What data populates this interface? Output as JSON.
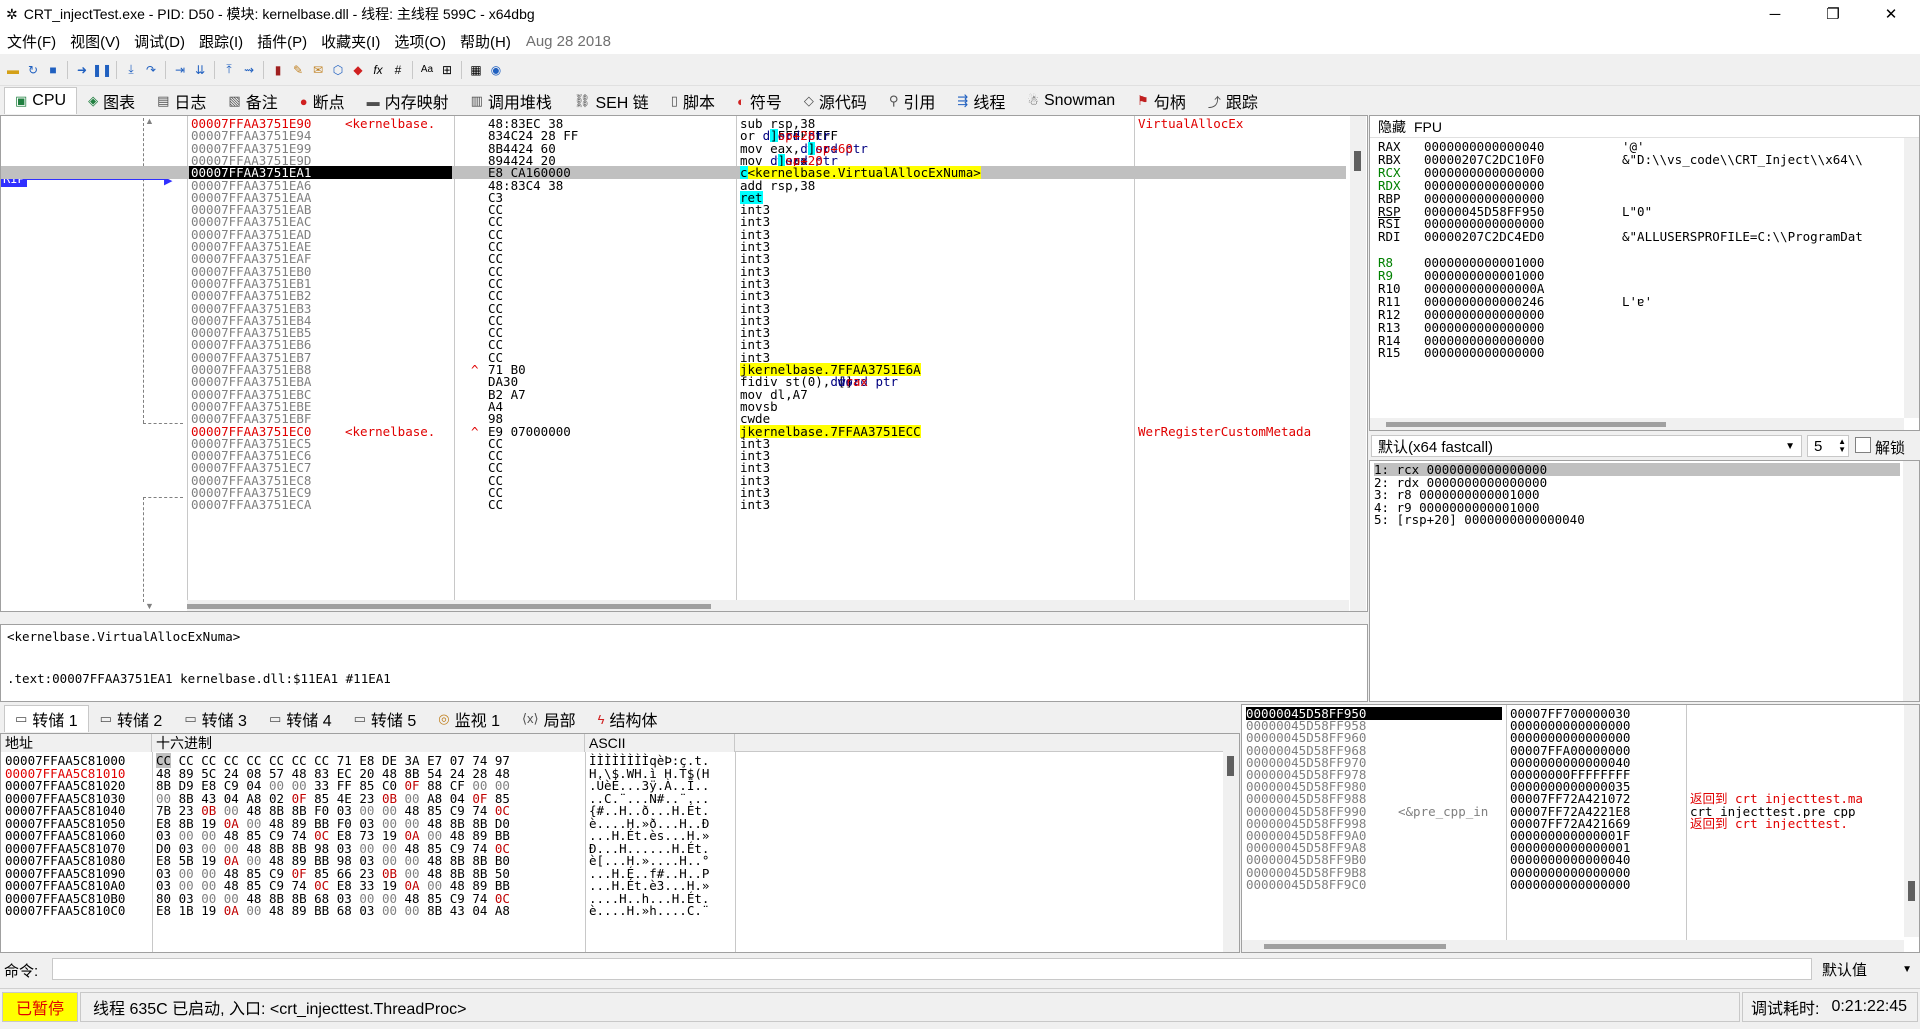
{
  "titlebar": {
    "title": "CRT_injectTest.exe - PID: D50 - 模块: kernelbase.dll - 线程: 主线程 599C - x64dbg"
  },
  "menu": {
    "items": [
      "文件(F)",
      "视图(V)",
      "调试(D)",
      "跟踪(I)",
      "插件(P)",
      "收藏夹(I)",
      "选项(O)",
      "帮助(H)"
    ],
    "date": "Aug 28 2018"
  },
  "tabs": [
    {
      "label": "CPU",
      "icon": "cpu-icon"
    },
    {
      "label": "图表",
      "icon": "graph-icon"
    },
    {
      "label": "日志",
      "icon": "log-icon"
    },
    {
      "label": "备注",
      "icon": "notes-icon"
    },
    {
      "label": "断点",
      "icon": "breakpoint-icon"
    },
    {
      "label": "内存映射",
      "icon": "memory-map-icon"
    },
    {
      "label": "调用堆栈",
      "icon": "call-stack-icon"
    },
    {
      "label": "SEH 链",
      "icon": "seh-icon"
    },
    {
      "label": "脚本",
      "icon": "script-icon"
    },
    {
      "label": "符号",
      "icon": "symbol-icon"
    },
    {
      "label": "源代码",
      "icon": "source-icon"
    },
    {
      "label": "引用",
      "icon": "references-icon"
    },
    {
      "label": "线程",
      "icon": "threads-icon"
    },
    {
      "label": "Snowman",
      "icon": "snowman-icon"
    },
    {
      "label": "句柄",
      "icon": "handles-icon"
    },
    {
      "label": "跟踪",
      "icon": "trace-icon"
    }
  ],
  "disasm": {
    "rip_label": "RIP",
    "rows": [
      {
        "addr": "00007FFAA3751E90",
        "label": "<kernelbase.",
        "bytes": "48:83EC 38",
        "instr": "sub rsp,38",
        "cmt": "VirtualAllocEx",
        "red": true
      },
      {
        "addr": "00007FFAA3751E94",
        "bytes": "834C24 28 FF",
        "instr": "or dword ptr ss:[rsp+28],FFFFFFFF"
      },
      {
        "addr": "00007FFAA3751E99",
        "bytes": "8B4424 60",
        "instr": "mov eax,dword ptr ss:[rsp+60]"
      },
      {
        "addr": "00007FFAA3751E9D",
        "bytes": "894424 20",
        "instr": "mov dword ptr ss:[rsp+20],eax"
      },
      {
        "addr": "00007FFAA3751EA1",
        "bytes": "E8 CA160000",
        "instr": "call <kernelbase.VirtualAllocExNuma>",
        "rip": true
      },
      {
        "addr": "00007FFAA3751EA6",
        "bytes": "48:83C4 38",
        "instr": "add rsp,38"
      },
      {
        "addr": "00007FFAA3751EAA",
        "bytes": "C3",
        "instr": "ret"
      },
      {
        "addr": "00007FFAA3751EAB",
        "bytes": "CC",
        "instr": "int3"
      },
      {
        "addr": "00007FFAA3751EAC",
        "bytes": "CC",
        "instr": "int3"
      },
      {
        "addr": "00007FFAA3751EAD",
        "bytes": "CC",
        "instr": "int3"
      },
      {
        "addr": "00007FFAA3751EAE",
        "bytes": "CC",
        "instr": "int3"
      },
      {
        "addr": "00007FFAA3751EAF",
        "bytes": "CC",
        "instr": "int3"
      },
      {
        "addr": "00007FFAA3751EB0",
        "bytes": "CC",
        "instr": "int3"
      },
      {
        "addr": "00007FFAA3751EB1",
        "bytes": "CC",
        "instr": "int3"
      },
      {
        "addr": "00007FFAA3751EB2",
        "bytes": "CC",
        "instr": "int3"
      },
      {
        "addr": "00007FFAA3751EB3",
        "bytes": "CC",
        "instr": "int3"
      },
      {
        "addr": "00007FFAA3751EB4",
        "bytes": "CC",
        "instr": "int3"
      },
      {
        "addr": "00007FFAA3751EB5",
        "bytes": "CC",
        "instr": "int3"
      },
      {
        "addr": "00007FFAA3751EB6",
        "bytes": "CC",
        "instr": "int3"
      },
      {
        "addr": "00007FFAA3751EB7",
        "bytes": "CC",
        "instr": "int3"
      },
      {
        "addr": "00007FFAA3751EB8",
        "bytes": "71 B0",
        "instr": "jno kernelbase.7FFAA3751E6A",
        "jump": true
      },
      {
        "addr": "00007FFAA3751EBA",
        "bytes": "DA30",
        "instr": "fidiv st(0),dword ptr ds:[rax]"
      },
      {
        "addr": "00007FFAA3751EBC",
        "bytes": "B2 A7",
        "instr": "mov dl,A7"
      },
      {
        "addr": "00007FFAA3751EBE",
        "bytes": "A4",
        "instr": "movsb"
      },
      {
        "addr": "00007FFAA3751EBF",
        "bytes": "98",
        "instr": "cwde"
      },
      {
        "addr": "00007FFAA3751EC0",
        "label": "<kernelbase.",
        "bytes": "E9 07000000",
        "instr": "jmp kernelbase.7FFAA3751ECC",
        "cmt": "WerRegisterCustomMetada",
        "red": true,
        "jump": true
      },
      {
        "addr": "00007FFAA3751EC5",
        "bytes": "CC",
        "instr": "int3"
      },
      {
        "addr": "00007FFAA3751EC6",
        "bytes": "CC",
        "instr": "int3"
      },
      {
        "addr": "00007FFAA3751EC7",
        "bytes": "CC",
        "instr": "int3"
      },
      {
        "addr": "00007FFAA3751EC8",
        "bytes": "CC",
        "instr": "int3"
      },
      {
        "addr": "00007FFAA3751EC9",
        "bytes": "CC",
        "instr": "int3"
      },
      {
        "addr": "00007FFAA3751ECA",
        "bytes": "CC",
        "instr": "int3"
      }
    ]
  },
  "disasm_info": {
    "line1": "<kernelbase.VirtualAllocExNuma>",
    "line2": ".text:00007FFAA3751EA1 kernelbase.dll:$11EA1 #11EA1"
  },
  "registers": {
    "header": [
      "隐藏",
      "FPU"
    ],
    "rows": [
      {
        "name": "RAX",
        "val": "0000000000000040",
        "cmt": "'@'"
      },
      {
        "name": "RBX",
        "val": "00000207C2DC10F0",
        "cmt": "&\"D:\\\\vs_code\\\\CRT_Inject\\\\x64\\\\"
      },
      {
        "name": "RCX",
        "val": "0000000000000000",
        "cmt": "",
        "green": true
      },
      {
        "name": "RDX",
        "val": "0000000000000000",
        "cmt": "",
        "green": true
      },
      {
        "name": "RBP",
        "val": "0000000000000000",
        "cmt": ""
      },
      {
        "name": "RSP",
        "val": "00000045D58FF950",
        "cmt": "L\"0\"",
        "uline": true
      },
      {
        "name": "RSI",
        "val": "0000000000000000",
        "cmt": ""
      },
      {
        "name": "RDI",
        "val": "00000207C2DC4ED0",
        "cmt": "&\"ALLUSERSPROFILE=C:\\\\ProgramDat"
      },
      {
        "name": "",
        "val": "",
        "cmt": ""
      },
      {
        "name": "R8",
        "val": "0000000000001000",
        "cmt": "",
        "green": true
      },
      {
        "name": "R9",
        "val": "0000000000001000",
        "cmt": "",
        "green": true
      },
      {
        "name": "R10",
        "val": "000000000000000A",
        "cmt": ""
      },
      {
        "name": "R11",
        "val": "0000000000000246",
        "cmt": "L'ɐ'"
      },
      {
        "name": "R12",
        "val": "0000000000000000",
        "cmt": ""
      },
      {
        "name": "R13",
        "val": "0000000000000000",
        "cmt": ""
      },
      {
        "name": "R14",
        "val": "0000000000000000",
        "cmt": ""
      },
      {
        "name": "R15",
        "val": "0000000000000000",
        "cmt": ""
      }
    ]
  },
  "callconv": {
    "selected": "默认(x64 fastcall)",
    "count": "5",
    "unlock_label": "解锁",
    "args": [
      "1: rcx 0000000000000000",
      "2: rdx 0000000000000000",
      "3: r8 0000000000001000",
      "4: r9 0000000000001000",
      "5: [rsp+20] 0000000000000040"
    ]
  },
  "dumptabs": [
    {
      "label": "转储 1",
      "icon": "dump-icon"
    },
    {
      "label": "转储 2",
      "icon": "dump-icon"
    },
    {
      "label": "转储 3",
      "icon": "dump-icon"
    },
    {
      "label": "转储 4",
      "icon": "dump-icon"
    },
    {
      "label": "转储 5",
      "icon": "dump-icon"
    },
    {
      "label": "监视 1",
      "icon": "watch-icon"
    },
    {
      "label": "局部",
      "icon": "locals-icon"
    },
    {
      "label": "结构体",
      "icon": "struct-icon"
    }
  ],
  "dump": {
    "headers": [
      "地址",
      "十六进制",
      "ASCII"
    ],
    "rows": [
      {
        "addr": "00007FFAA5C81000",
        "hex": "CC CC CC CC CC CC CC CC 71 E8 DE 3A E7 07 74 97",
        "ascii": "ÌÌÌÌÌÌÌÌqèÞ:ç.t."
      },
      {
        "addr": "00007FFAA5C81010",
        "hex": "48 89 5C 24 08 57 48 83 EC 20 48 8B 54 24 28 48",
        "ascii": "H.\\$.WH.ì H.T$(H",
        "red": true
      },
      {
        "addr": "00007FFAA5C81020",
        "hex": "8B D9 E8 C9 04 00 00 33 FF 85 C0 0F 88 CF 00 00",
        "ascii": ".ÙèÉ...3ÿ.À..Ï.."
      },
      {
        "addr": "00007FFAA5C81030",
        "hex": "00 8B 43 04 A8 02 0F 85 4E 23 0B 00 A8 04 0F 85",
        "ascii": "..C.¨...N#..¨..."
      },
      {
        "addr": "00007FFAA5C81040",
        "hex": "7B 23 0B 00 48 8B 8B F0 03 00 00 48 85 C9 74 0C",
        "ascii": "{#..H..ð...H.Ét."
      },
      {
        "addr": "00007FFAA5C81050",
        "hex": "E8 8B 19 0A 00 48 89 BB F0 03 00 00 48 8B 8B D0",
        "ascii": "è....H.»ð...H..Ð"
      },
      {
        "addr": "00007FFAA5C81060",
        "hex": "03 00 00 48 85 C9 74 0C E8 73 19 0A 00 48 89 BB",
        "ascii": "...H.Ét.ès...H.»"
      },
      {
        "addr": "00007FFAA5C81070",
        "hex": "D0 03 00 00 48 8B 8B 98 03 00 00 48 85 C9 74 0C",
        "ascii": "Ð...H......H.Ét."
      },
      {
        "addr": "00007FFAA5C81080",
        "hex": "E8 5B 19 0A 00 48 89 BB 98 03 00 00 48 8B 8B B0",
        "ascii": "è[...H.»....H..°"
      },
      {
        "addr": "00007FFAA5C81090",
        "hex": "03 00 00 48 85 C9 0F 85 66 23 0B 00 48 8B 8B 50",
        "ascii": "...H.É..f#..H..P"
      },
      {
        "addr": "00007FFAA5C810A0",
        "hex": "03 00 00 48 85 C9 74 0C E8 33 19 0A 00 48 89 BB",
        "ascii": "...H.Ét.è3...H.»"
      },
      {
        "addr": "00007FFAA5C810B0",
        "hex": "80 03 00 00 48 8B 8B 68 03 00 00 48 85 C9 74 0C",
        "ascii": "....H..h...H.Ét."
      },
      {
        "addr": "00007FFAA5C810C0",
        "hex": "E8 1B 19 0A 00 48 89 BB 68 03 00 00 8B 43 04 A8",
        "ascii": "è....H.»h....C.¨"
      }
    ]
  },
  "stack": {
    "rows": [
      {
        "addr": "00000045D58FF950",
        "val": "00007FF700000030",
        "cmt": "",
        "sel": true
      },
      {
        "addr": "00000045D58FF958",
        "val": "0000000000000000",
        "cmt": ""
      },
      {
        "addr": "00000045D58FF960",
        "val": "0000000000000000",
        "cmt": ""
      },
      {
        "addr": "00000045D58FF968",
        "val": "00007FFA00000000",
        "cmt": ""
      },
      {
        "addr": "00000045D58FF970",
        "val": "0000000000000040",
        "cmt": ""
      },
      {
        "addr": "00000045D58FF978",
        "val": "00000000FFFFFFFF",
        "cmt": ""
      },
      {
        "addr": "00000045D58FF980",
        "val": "0000000000000035",
        "cmt": ""
      },
      {
        "addr": "00000045D58FF988",
        "val": "00007FF72A421072",
        "cmt": "返回到 crt_injecttest.ma",
        "red": true
      },
      {
        "addr": "00000045D58FF990",
        "label": "<&pre_cpp_in",
        "val": "00007FF72A4221E8",
        "cmt": "crt_injecttest.pre_cpp_"
      },
      {
        "addr": "00000045D58FF998",
        "val": "00007FF72A421669",
        "cmt": "返回到 crt_injecttest.__",
        "red": true
      },
      {
        "addr": "00000045D58FF9A0",
        "val": "000000000000001F",
        "cmt": ""
      },
      {
        "addr": "00000045D58FF9A8",
        "val": "0000000000000001",
        "cmt": ""
      },
      {
        "addr": "00000045D58FF9B0",
        "val": "0000000000000040",
        "cmt": ""
      },
      {
        "addr": "00000045D58FF9B8",
        "val": "0000000000000000",
        "cmt": ""
      },
      {
        "addr": "00000045D58FF9C0",
        "val": "0000000000000000",
        "cmt": ""
      }
    ]
  },
  "command": {
    "label": "命令:",
    "value": "",
    "default_label": "默认值"
  },
  "status": {
    "state": "已暂停",
    "message": "线程 635C 已启动, 入口: <crt_injecttest.ThreadProc>",
    "time_label": "调试耗时:",
    "time": "0:21:22:45"
  }
}
